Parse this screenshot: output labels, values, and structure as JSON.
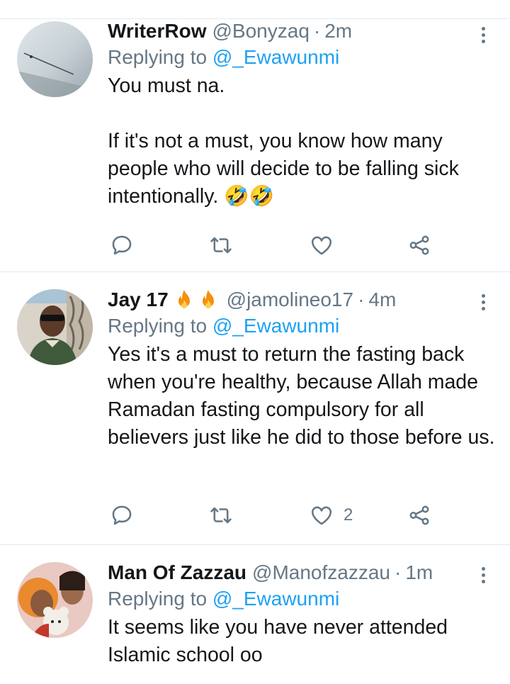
{
  "tweets": [
    {
      "name": "WriterRow",
      "handle": "@Bonyzaq",
      "separator": "·",
      "time": "2m",
      "replying_label": "Replying to ",
      "replying_to": "@_Ewawunmi",
      "text": "You must na.\n\nIf it's not a must, you know how many people who will decide to be falling sick intentionally. 🤣🤣",
      "likes": "",
      "name_emojis": []
    },
    {
      "name": "Jay 17",
      "handle": "@jamolineo17",
      "separator": "·",
      "time": "4m",
      "replying_label": "Replying to ",
      "replying_to": "@_Ewawunmi",
      "text": "Yes it's a must to return the fasting back when you're healthy, because Allah made Ramadan fasting compulsory for all believers just like he did to those before us.",
      "likes": "2",
      "name_emojis": [
        "fire-emoji",
        "fire-emoji"
      ]
    },
    {
      "name": "Man Of Zazzau",
      "handle": "@Manofzazzau",
      "separator": "·",
      "time": "1m",
      "replying_label": "Replying to ",
      "replying_to": "@_Ewawunmi",
      "text": "It seems like you have never attended Islamic school oo",
      "likes": "",
      "name_emojis": []
    }
  ],
  "icons": {
    "reply": "reply-icon",
    "retweet": "retweet-icon",
    "like": "heart-icon",
    "share": "share-icon",
    "more": "more-vertical-icon"
  },
  "colors": {
    "text": "#14171a",
    "secondary": "#657786",
    "accent": "#1da1f2",
    "divider": "#e1e8ed",
    "fire": "#f4900c"
  }
}
